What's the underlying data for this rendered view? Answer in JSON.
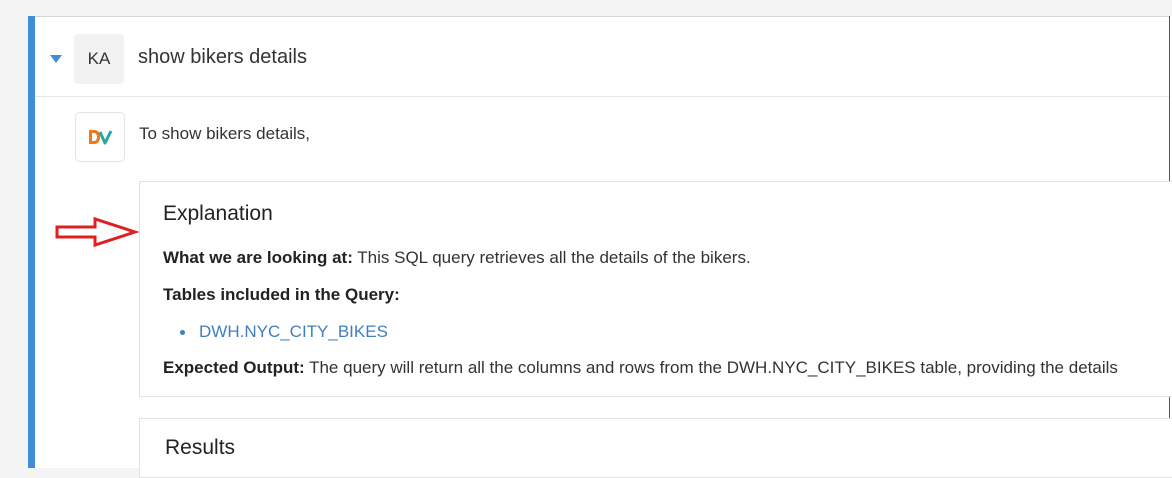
{
  "query": {
    "user_initials": "KA",
    "text": "show bikers details"
  },
  "response": {
    "intro": "To show bikers details,",
    "explanation": {
      "title": "Explanation",
      "looking_at_label": "What we are looking at:",
      "looking_at_text": "This SQL query retrieves all the details of the bikers.",
      "tables_label": "Tables included in the Query:",
      "tables": [
        "DWH.NYC_CITY_BIKES"
      ],
      "expected_label": "Expected Output:",
      "expected_text": "The query will return all the columns and rows from the DWH.NYC_CITY_BIKES table, providing the details"
    },
    "results": {
      "title": "Results"
    }
  },
  "colors": {
    "accent": "#3f8fd6",
    "link": "#3f7fc0",
    "annotation_arrow": "#e02020",
    "logo_orange": "#f07a1a",
    "logo_teal": "#2aa6a0"
  },
  "icons": {
    "collapse": "caret-down-icon",
    "bot": "dv-logo-icon",
    "annotation": "red-arrow-icon"
  }
}
